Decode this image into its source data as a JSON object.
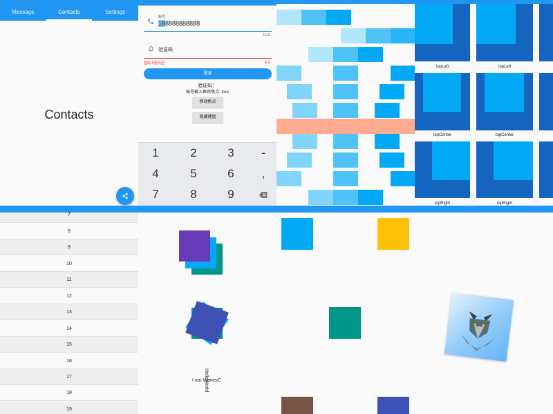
{
  "tabs": {
    "items": [
      {
        "label": "Message"
      },
      {
        "label": "Contacts"
      },
      {
        "label": "Settings"
      }
    ],
    "active_title": "Contacts"
  },
  "login": {
    "phone_label": "账号",
    "phone_value_highlight": "18",
    "phone_value_rest": "8888888888",
    "phone_counter": "11/11",
    "code_label": "验证码",
    "error_text": "密码不能为空",
    "code_counter": "0/11",
    "login_button": "登录",
    "code_text": "验证码：",
    "focus_text": "账号输入框获焦点: true",
    "move_focus_button": "移动焦点",
    "hide_keyboard_button": "隐藏键盘",
    "keys": [
      "1",
      "2",
      "3",
      "-",
      "4",
      "5",
      "6",
      ",",
      "7",
      "8",
      "9"
    ]
  },
  "alignment": {
    "captions": [
      "topLeft",
      "topLeft",
      "topCenter",
      "topCenter",
      "topRight",
      "topRight"
    ]
  },
  "list": {
    "rows": [
      "7",
      "8",
      "9",
      "10",
      "11",
      "12",
      "13",
      "14",
      "15",
      "16",
      "17",
      "18",
      "19"
    ]
  },
  "transforms": {
    "text": "I am WavesC",
    "rotated_text": "HelloWorld"
  },
  "colors": {
    "primary": "#2196f3",
    "light_blue": "#03a9f4",
    "dark_blue": "#1565c0",
    "amber": "#ffc107",
    "teal": "#009688",
    "brown": "#795548",
    "indigo": "#3f51b5",
    "deep_purple": "#673ab7",
    "salmon": "#ffab91",
    "error": "#e53935"
  },
  "icons": {
    "share": "share-icon",
    "phone": "phone-icon",
    "bell": "bell-icon",
    "backspace": "backspace-icon"
  }
}
